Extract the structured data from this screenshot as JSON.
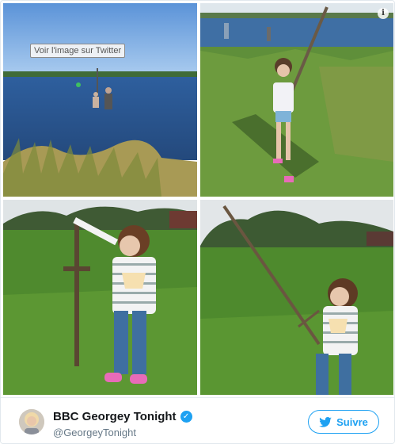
{
  "photos": {
    "tooltip_text": "Voir l'image sur Twitter",
    "info_icon": "info-icon"
  },
  "author": {
    "name": "BBC Georgey Tonight",
    "handle": "@GeorgeyTonight",
    "verified_icon": "verified-badge-icon",
    "avatar_icon": "avatar"
  },
  "follow": {
    "label": "Suivre",
    "icon": "twitter-bird-icon",
    "color": "#1da1f2"
  }
}
